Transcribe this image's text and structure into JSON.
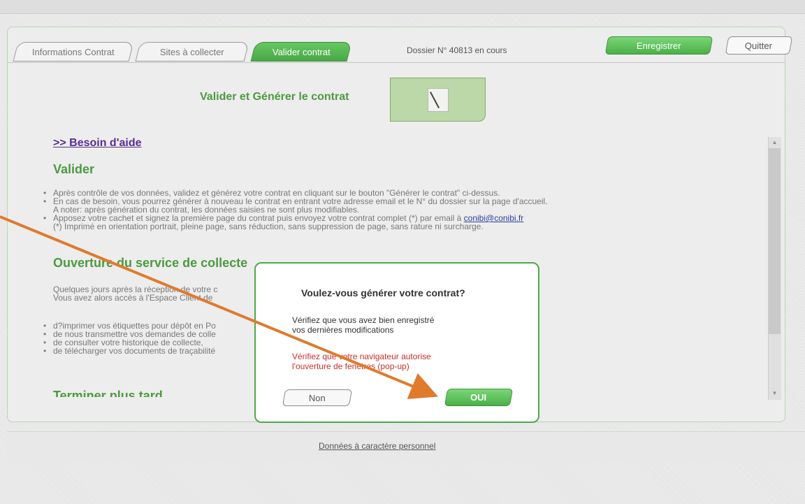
{
  "tabs": [
    {
      "label": "Informations Contrat",
      "active": false
    },
    {
      "label": "Sites à collecter",
      "active": false
    },
    {
      "label": "Valider contrat",
      "active": true
    }
  ],
  "header": {
    "dossier_status": "Dossier N° 40813 en cours",
    "save_label": "Enregistrer",
    "quit_label": "Quitter"
  },
  "main": {
    "heading": "Valider et Générer le contrat",
    "doc_icon": "document-pen-icon",
    "help_link": ">> Besoin d'aide",
    "sections": {
      "valider": {
        "title": "Valider",
        "items": [
          "Après contrôle de vos données, validez et générez votre contrat en cliquant sur le bouton \"Générer le contrat\" ci-dessus.",
          "En cas de besoin, vous pourrez générer à nouveau le contrat en entrant votre adresse email et le N° du dossier sur la page d'accueil.",
          "A noter: après génération du contrat, les données saisies ne sont plus modifiables.",
          "Apposez votre cachet et signez la première page du contrat puis envoyez votre contrat complet (*) par email à",
          "conibi@conibi.fr",
          "(*) Imprimé en orientation portrait, pleine page, sans réduction, sans suppression de page, sans rature ni surcharge."
        ]
      },
      "ouverture": {
        "title": "Ouverture du service de collecte",
        "para_line1": "Quelques jours après la réception de votre c",
        "para_line2": "Vous avez alors accès à l'Espace Client de",
        "items": [
          "d?imprimer vos étiquettes pour dépôt en Po",
          "de nous transmettre vos demandes de colle",
          "de consulter votre historique de collecte,",
          "de télécharger vos documents de traçabilité"
        ]
      },
      "terminer": {
        "title": "Terminer plus tard"
      }
    }
  },
  "modal": {
    "title": "Voulez-vous générer votre contrat?",
    "check_line1": "Vérifiez que vous avez bien enregistré",
    "check_line2": "vos dernières modifications",
    "warn_line1": "Vérifiez que votre navigateur autorise",
    "warn_line2": "l'ouverture de fenêtres (pop-up)",
    "no_label": "Non",
    "yes_label": "OUI"
  },
  "footer": {
    "link": "Données à caractère personnel"
  },
  "colors": {
    "accent_green": "#4c9a3f",
    "button_green": "#4bb048",
    "warning_red": "#c6302b",
    "link_purple": "#5a2e91",
    "annotation_arrow": "#e07a2d"
  }
}
